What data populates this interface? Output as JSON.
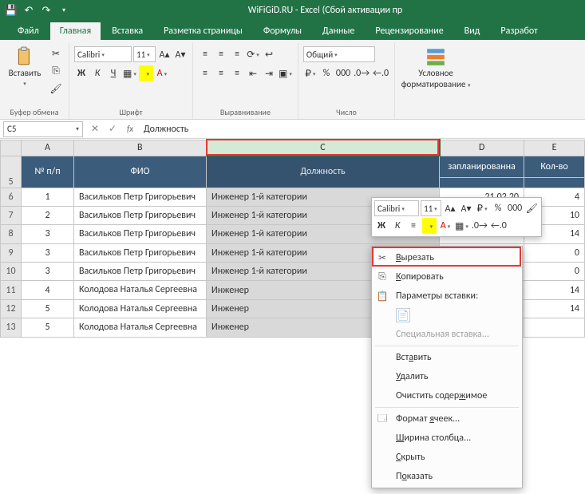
{
  "title": "WiFiGiD.RU - Excel (Сбой активации пр",
  "tabs": {
    "file": "Файл",
    "home": "Главная",
    "insert": "Вставка",
    "pagelayout": "Разметка страницы",
    "formulas": "Формулы",
    "data": "Данные",
    "review": "Рецензирование",
    "view": "Вид",
    "developer": "Разработ"
  },
  "ribbon": {
    "paste": "Вставить",
    "clipboard_label": "Буфер обмена",
    "font_name": "Calibri",
    "font_size": "11",
    "font_label": "Шрифт",
    "align_label": "Выравнивание",
    "number_format": "Общий",
    "number_label": "Число",
    "condfmt_line1": "Условное",
    "condfmt_line2": "форматирование"
  },
  "namebox": "C5",
  "formula_value": "Должность",
  "col_headers": {
    "A": "A",
    "B": "B",
    "C": "C",
    "D": "D",
    "E": "E"
  },
  "table_headers": {
    "num": "№ п/п",
    "fio": "ФИО",
    "position": "Должность",
    "planned": "запланированна",
    "qty": "Кол-во"
  },
  "rows": [
    {
      "rh": "5"
    },
    {
      "rh": "6",
      "num": "1",
      "fio": "Васильков Петр Григорьевич",
      "pos": "Инженер 1-й категории",
      "d": "21.02.20",
      "e": "4"
    },
    {
      "rh": "7",
      "num": "2",
      "fio": "Васильков Петр Григорьевич",
      "pos": "Инженер 1-й категории",
      "d": "",
      "e": "10"
    },
    {
      "rh": "8",
      "num": "3",
      "fio": "Васильков Петр Григорьевич",
      "pos": "Инженер 1-й категории",
      "d": "",
      "e": "14"
    },
    {
      "rh": "9",
      "num": "3",
      "fio": "Васильков Петр Григорьевич",
      "pos": "Инженер 1-й категории",
      "d": "",
      "e": "0"
    },
    {
      "rh": "10",
      "num": "3",
      "fio": "Васильков Петр Григорьевич",
      "pos": "Инженер 1-й категории",
      "d": "",
      "e": "0"
    },
    {
      "rh": "11",
      "num": "4",
      "fio": "Колодова Наталья Сергеевна",
      "pos": "Инженер",
      "d": "",
      "e": "14"
    },
    {
      "rh": "12",
      "num": "5",
      "fio": "Колодова Наталья Сергеевна",
      "pos": "Инженер",
      "d": "",
      "e": "14"
    },
    {
      "rh": "13",
      "num": "5",
      "fio": "Колодова Наталья Сергеевна",
      "pos": "Инженер",
      "d": "",
      "e": ""
    }
  ],
  "mini_toolbar": {
    "font_name": "Calibri",
    "font_size": "11"
  },
  "context_menu": {
    "cut": "Вырезать",
    "copy": "Копировать",
    "paste_options": "Параметры вставки:",
    "paste_special": "Специальная вставка...",
    "insert": "Вставить",
    "delete": "Удалить",
    "clear": "Очистить содержимое",
    "format_cells": "Формат ячеек...",
    "col_width": "Ширина столбца...",
    "hide": "Скрыть",
    "show": "Показать"
  }
}
